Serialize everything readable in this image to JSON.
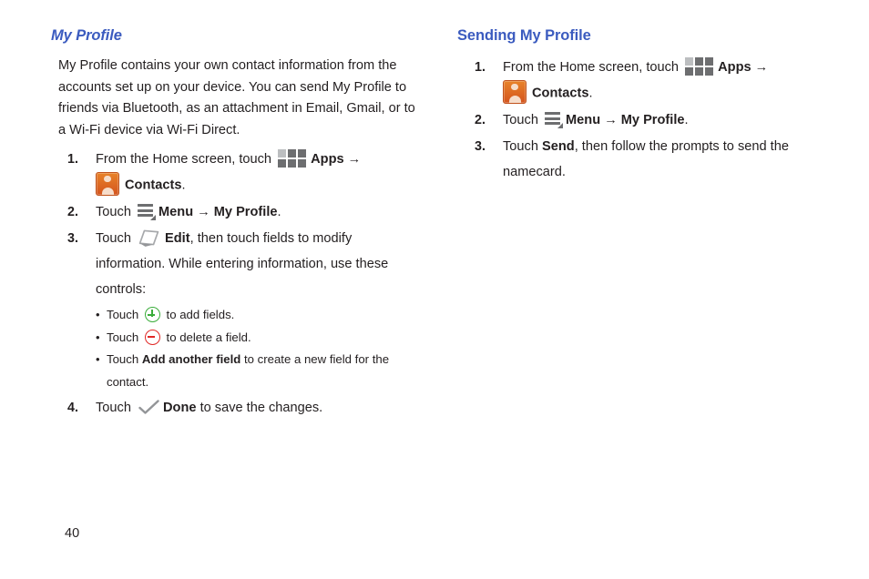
{
  "page": {
    "number": "40"
  },
  "icons": {
    "apps": "apps-grid-icon",
    "contacts": "contacts-icon",
    "menu": "menu-icon",
    "edit": "edit-pencil-icon",
    "plus": "add-circle-icon",
    "minus": "delete-circle-icon",
    "check": "done-check-icon",
    "arrow": "→",
    "bullet": "•"
  },
  "colors": {
    "heading": "#3b5bbf",
    "body_text": "#231f20",
    "icon_gray": "#6d6e70",
    "icon_gray_light": "#bcbec0",
    "contacts_orange": "#d4541d",
    "plus_green": "#3aad3a",
    "minus_red": "#e02826"
  },
  "left_column": {
    "heading": "My Profile",
    "paragraph": "My Profile contains your own contact information from the accounts set up on your device. You can send My Profile to friends via Bluetooth, as an attachment in Email, Gmail, or to a Wi-Fi device via Wi-Fi Direct.",
    "steps": [
      {
        "number": "1.",
        "text_1": "From the Home screen, touch",
        "apps_label": "Apps",
        "contacts_label": "Contacts",
        "text_end": "."
      },
      {
        "number": "2.",
        "text_1": "Touch",
        "menu_label": "Menu",
        "target_label": "My Profile",
        "text_end": "."
      },
      {
        "number": "3.",
        "text_1": "Touch",
        "edit_label": "Edit",
        "text_2": ", then touch fields to modify information. While entering information, use these controls:",
        "bullets": [
          {
            "pre": "Touch",
            "icon": "plus",
            "post": "to add fields."
          },
          {
            "pre": "Touch",
            "icon": "minus",
            "post": "to delete a field."
          },
          {
            "pre": "Touch",
            "bold": "Add another field",
            "post": "to create a new field for the contact."
          }
        ]
      },
      {
        "number": "4.",
        "text_1": "Touch",
        "done_label": "Done",
        "text_2": "to save the changes."
      }
    ]
  },
  "right_column": {
    "heading": "Sending My Profile",
    "steps": [
      {
        "number": "1.",
        "text_1": "From the Home screen, touch",
        "apps_label": "Apps",
        "contacts_label": "Contacts",
        "text_end": "."
      },
      {
        "number": "2.",
        "text_1": "Touch",
        "menu_label": "Menu",
        "target_label": "My Profile",
        "text_end": "."
      },
      {
        "number": "3.",
        "text_1": "Touch",
        "send_label": "Send",
        "text_2": ", then follow the prompts to send the namecard."
      }
    ]
  }
}
